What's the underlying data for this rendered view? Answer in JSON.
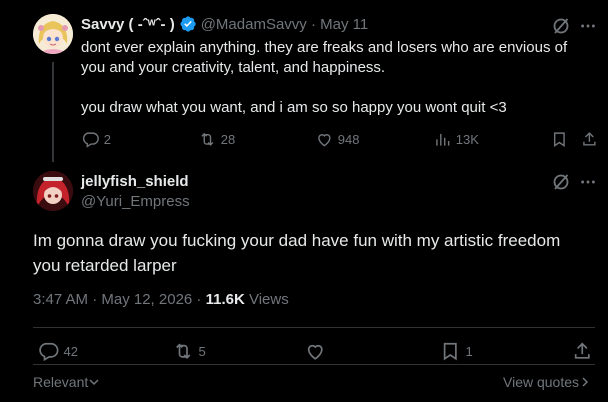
{
  "parent": {
    "display_name": "Savvy ( -ˆʷˆ- )",
    "handle_date": "@MadamSavvy · May 11",
    "body_line1": "dont ever explain anything. they are freaks and losers who are envious of you and your creativity, talent, and happiness.",
    "body_line2": "you draw what you want, and i am so so happy you wont quit <3",
    "counts": {
      "replies": "2",
      "reposts": "28",
      "likes": "948",
      "views": "13K"
    }
  },
  "reply": {
    "display_name": "jellyfish_shield",
    "handle": "@Yuri_Empress",
    "text": "Im gonna draw you fucking your dad have fun with my artistic freedom you retarded larper",
    "timestamp": "3:47 AM · May 12, 2026 · ",
    "views_count": "11.6K",
    "views_label": " Views",
    "counts": {
      "replies": "42",
      "reposts": "5",
      "bookmarks": "1"
    }
  },
  "footer": {
    "relevant_label": "Relevant",
    "view_quotes_label": "View quotes"
  },
  "colors": {
    "verified": "#1d9bf0",
    "muted": "#71767b",
    "text": "#e7e9ea",
    "divider": "#2f3336"
  }
}
